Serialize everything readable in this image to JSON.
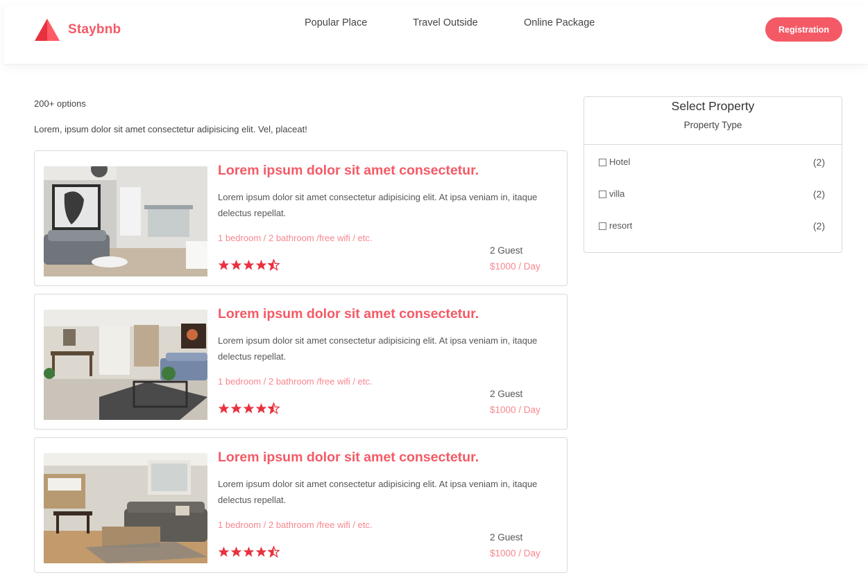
{
  "brand": {
    "name": "Staybnb",
    "accent": "#f35a66",
    "accent_light": "#f8868f"
  },
  "nav": {
    "items": [
      "Popular Place",
      "Travel Outside",
      "Online Package"
    ]
  },
  "header": {
    "registration_label": "Registration"
  },
  "listing": {
    "count_text": "200+ options",
    "intro_text": "Lorem, ipsum dolor sit amet consectetur adipisicing elit. Vel, placeat!",
    "cards": [
      {
        "title": "Lorem ipsum dolor sit amet consectetur.",
        "description": "Lorem ipsum dolor sit amet consectetur adipisicing elit. At ipsa veniam in, itaque delectus repellat.",
        "amenities": "1 bedroom / 2 bathroom /free wifi / etc.",
        "guests": "2 Guest",
        "price": "$1000 / Day",
        "rating": 4.5,
        "photo": "living-room-photo"
      },
      {
        "title": "Lorem ipsum dolor sit amet consectetur.",
        "description": "Lorem ipsum dolor sit amet consectetur adipisicing elit. At ipsa veniam in, itaque delectus repellat.",
        "amenities": "1 bedroom / 2 bathroom /free wifi / etc.",
        "guests": "2 Guest",
        "price": "$1000 / Day",
        "rating": 4.5,
        "photo": "living-room-photo"
      },
      {
        "title": "Lorem ipsum dolor sit amet consectetur.",
        "description": "Lorem ipsum dolor sit amet consectetur adipisicing elit. At ipsa veniam in, itaque delectus repellat.",
        "amenities": "1 bedroom / 2 bathroom /free wifi / etc.",
        "guests": "2 Guest",
        "price": "$1000 / Day",
        "rating": 4.5,
        "photo": "living-room-photo"
      }
    ]
  },
  "filter": {
    "title": "Select Property",
    "subtitle": "Property Type",
    "options": [
      {
        "label": "Hotel",
        "count": "(2)",
        "checked": false
      },
      {
        "label": "villa",
        "count": "(2)",
        "checked": false
      },
      {
        "label": "resort",
        "count": "(2)",
        "checked": false
      }
    ]
  },
  "icons": {
    "logo": "triangle-logo-icon",
    "star": "star-icon",
    "half_star": "half-star-icon",
    "checkbox": "checkbox-icon"
  }
}
